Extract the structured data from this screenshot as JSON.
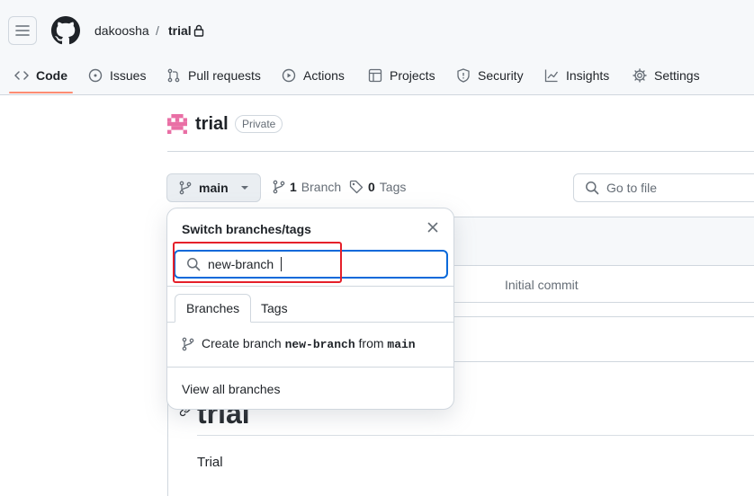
{
  "header": {
    "owner": "dakoosha",
    "separator": "/",
    "repo": "trial"
  },
  "tabs": [
    {
      "label": "Code",
      "icon": "code-icon",
      "active": true
    },
    {
      "label": "Issues",
      "icon": "issue-icon"
    },
    {
      "label": "Pull requests",
      "icon": "pull-request-icon"
    },
    {
      "label": "Actions",
      "icon": "play-icon"
    },
    {
      "label": "Projects",
      "icon": "table-icon"
    },
    {
      "label": "Security",
      "icon": "shield-icon"
    },
    {
      "label": "Insights",
      "icon": "graph-icon"
    },
    {
      "label": "Settings",
      "icon": "gear-icon"
    }
  ],
  "repo": {
    "title": "trial",
    "visibility": "Private"
  },
  "toolbar": {
    "branch": "main",
    "branch_count": "1",
    "branch_word": "Branch",
    "tag_count": "0",
    "tag_word": "Tags",
    "goto_placeholder": "Go to file"
  },
  "files": {
    "commit_message": "Initial commit",
    "readme_heading": "trial",
    "readme_text": "Trial"
  },
  "dropdown": {
    "title": "Switch branches/tags",
    "search_value": "new-branch",
    "tab_branches": "Branches",
    "tab_tags": "Tags",
    "create_prefix": "Create branch",
    "create_name": "new-branch",
    "create_from": "from",
    "create_source": "main",
    "view_all": "View all branches"
  },
  "colors": {
    "accent": "#0969da",
    "tab_underline": "#fd8c73",
    "highlight": "#e5202a"
  }
}
